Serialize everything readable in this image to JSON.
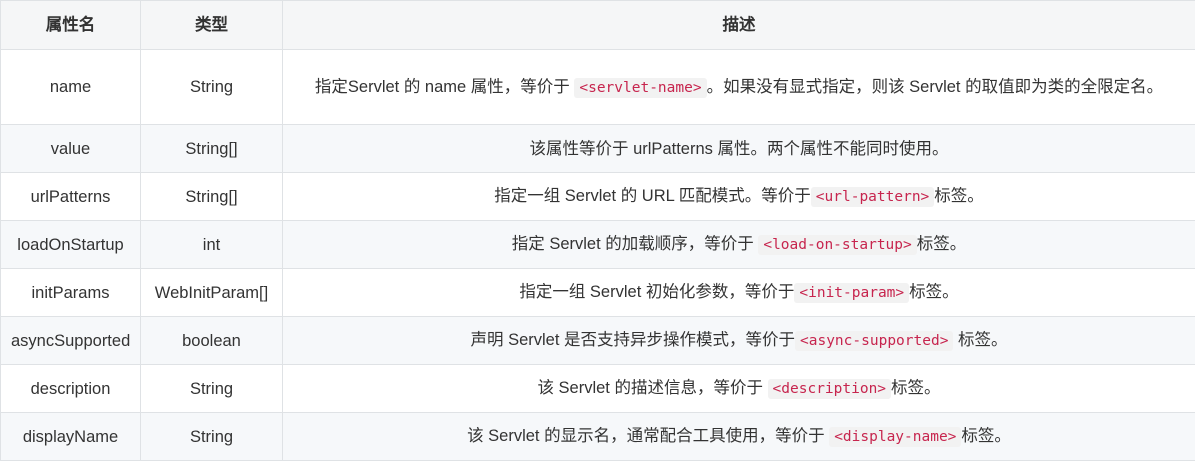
{
  "headers": [
    "属性名",
    "类型",
    "描述"
  ],
  "rows": [
    {
      "name": "name",
      "type": "String",
      "desc": [
        {
          "t": "text",
          "v": "指定Servlet 的 name 属性，等价于 "
        },
        {
          "t": "code",
          "v": "<servlet-name>"
        },
        {
          "t": "text",
          "v": "。如果没有显式指定，则该 Servlet 的取值即为类的全限定名。"
        }
      ]
    },
    {
      "name": "value",
      "type": "String[]",
      "desc": [
        {
          "t": "text",
          "v": "该属性等价于 urlPatterns 属性。两个属性不能同时使用。"
        }
      ]
    },
    {
      "name": "urlPatterns",
      "type": "String[]",
      "desc": [
        {
          "t": "text",
          "v": "指定一组 Servlet 的 URL 匹配模式。等价于"
        },
        {
          "t": "code",
          "v": "<url-pattern>"
        },
        {
          "t": "text",
          "v": "标签。"
        }
      ]
    },
    {
      "name": "loadOnStartup",
      "type": "int",
      "desc": [
        {
          "t": "text",
          "v": "指定 Servlet 的加载顺序，等价于 "
        },
        {
          "t": "code",
          "v": "<load-on-startup>"
        },
        {
          "t": "text",
          "v": "标签。"
        }
      ]
    },
    {
      "name": "initParams",
      "type": "WebInitParam[]",
      "desc": [
        {
          "t": "text",
          "v": "指定一组 Servlet 初始化参数，等价于"
        },
        {
          "t": "code",
          "v": "<init-param>"
        },
        {
          "t": "text",
          "v": "标签。"
        }
      ]
    },
    {
      "name": "asyncSupported",
      "type": "boolean",
      "desc": [
        {
          "t": "text",
          "v": "声明 Servlet 是否支持异步操作模式，等价于"
        },
        {
          "t": "code",
          "v": "<async-supported>"
        },
        {
          "t": "text",
          "v": " 标签。"
        }
      ]
    },
    {
      "name": "description",
      "type": "String",
      "desc": [
        {
          "t": "text",
          "v": "该 Servlet 的描述信息，等价于 "
        },
        {
          "t": "code",
          "v": "<description>"
        },
        {
          "t": "text",
          "v": "标签。"
        }
      ]
    },
    {
      "name": "displayName",
      "type": "String",
      "desc": [
        {
          "t": "text",
          "v": "该 Servlet 的显示名，通常配合工具使用，等价于 "
        },
        {
          "t": "code",
          "v": "<display-name>"
        },
        {
          "t": "text",
          "v": "标签。"
        }
      ]
    }
  ]
}
